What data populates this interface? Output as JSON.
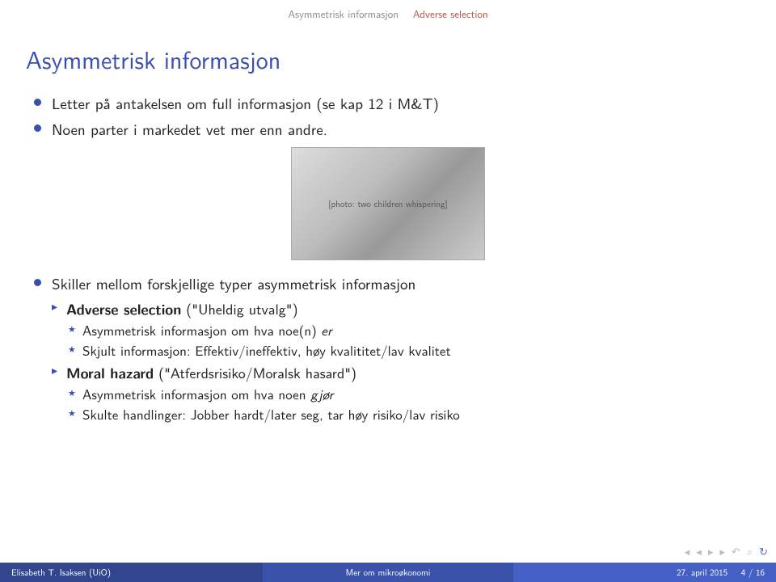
{
  "headline": {
    "section": "Asymmetrisk informasjon",
    "subsection": "Adverse selection"
  },
  "title": "Asymmetrisk informasjon",
  "bullets": {
    "b1": "Letter på antakelsen om full informasjon (se kap 12 i M&T)",
    "b2": "Noen parter i markedet vet mer enn andre.",
    "b3": "Skiller mellom forskjellige typer asymmetrisk informasjon",
    "b3a_bold": "Adverse selection",
    "b3a_rest": " (\"Uheldig utvalg\")",
    "b3a1_pre": "Asymmetrisk informasjon om hva noe(n) ",
    "b3a1_it": "er",
    "b3a2": "Skjult informasjon: Effektiv/ineffektiv, høy kvalititet/lav kvalitet",
    "b3b_bold": "Moral hazard",
    "b3b_rest": " (\"Atferdsrisiko/Moralsk hasard\")",
    "b3b1_pre": "Asymmetrisk informasjon om hva noen ",
    "b3b1_it": "gjør",
    "b3b2": "Skulte handlinger: Jobber hardt/later seg, tar høy risiko/lav risiko"
  },
  "image_alt": "[photo: two children whispering]",
  "footer": {
    "author": "Elisabeth T. Isaksen (UiO)",
    "title": "Mer om mikroøkonomi",
    "date": "27. april 2015",
    "page": "4 / 16"
  },
  "nav": {
    "first": "◂",
    "prev": "◂",
    "next": "▸",
    "last": "▸",
    "back": "↶",
    "search": "⌕",
    "loop": "↻"
  }
}
